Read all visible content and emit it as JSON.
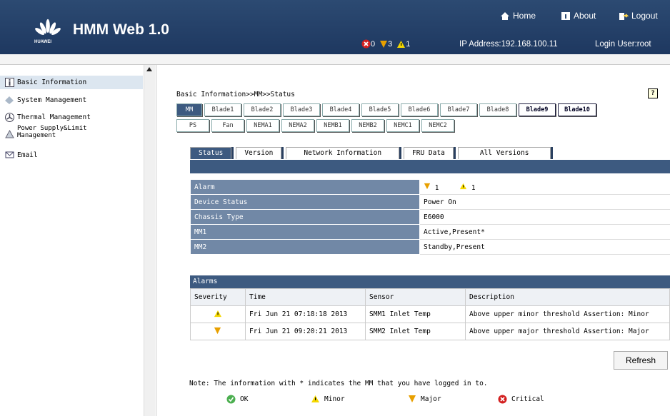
{
  "header": {
    "logo_text": "HUAWEI",
    "title": "HMM Web 1.0",
    "home": "Home",
    "about": "About",
    "logout": "Logout",
    "critical_count": "0",
    "major_count": "3",
    "minor_count": "1",
    "ip_address": "IP Address:192.168.100.11",
    "login_user": "Login User:root"
  },
  "sidebar": {
    "items": [
      {
        "label": "Basic Information",
        "icon": "info-icon"
      },
      {
        "label": "System Management",
        "icon": "system-icon"
      },
      {
        "label": "Thermal Management",
        "icon": "fan-icon"
      },
      {
        "label": "Power Supply&Limit",
        "label2": "Management",
        "icon": "power-icon"
      },
      {
        "label": "Email",
        "icon": "email-icon"
      }
    ]
  },
  "main": {
    "breadcrumb": "Basic Information>>MM>>Status",
    "help": "?",
    "row1": [
      "MM",
      "Blade1",
      "Blade2",
      "Blade3",
      "Blade4",
      "Blade5",
      "Blade6",
      "Blade7",
      "Blade8",
      "Blade9",
      "Blade10"
    ],
    "row2": [
      "PS",
      "Fan",
      "NEMA1",
      "NEMA2",
      "NEMB1",
      "NEMB2",
      "NEMC1",
      "NEMC2"
    ],
    "tabs": [
      "Status",
      "Version",
      "Network Information",
      "FRU Data",
      "All Versions"
    ],
    "status_rows": {
      "alarm_label": "Alarm",
      "alarm_major": "1",
      "alarm_minor": "1",
      "device_status_label": "Device Status",
      "device_status": "Power On",
      "chassis_type_label": "Chassis Type",
      "chassis_type": "E6000",
      "mm1_label": "MM1",
      "mm1": "Active,Present*",
      "mm2_label": "MM2",
      "mm2": "Standby,Present"
    },
    "alarms": {
      "title": "Alarms",
      "columns": [
        "Severity",
        "Time",
        "Sensor",
        "Description"
      ],
      "rows": [
        {
          "time": "Fri Jun 21 07:18:18 2013",
          "sensor": "SMM1 Inlet Temp",
          "description": "Above upper minor threshold Assertion: Minor"
        },
        {
          "time": "Fri Jun 21 09:20:21 2013",
          "sensor": "SMM2 Inlet Temp",
          "description": "Above upper major threshold Assertion: Major"
        }
      ]
    },
    "refresh": "Refresh",
    "note": "Note: The information with * indicates the MM that you have logged in to.",
    "legend": {
      "ok": "OK",
      "minor": "Minor",
      "major": "Major",
      "critical": "Critical"
    }
  },
  "colors": {
    "header": "#2c4a72",
    "panel": "#3d5a80",
    "key": "#7188a6",
    "ok": "#4caf50",
    "minor": "#e6c100",
    "major": "#e8a000",
    "critical": "#d32020"
  }
}
